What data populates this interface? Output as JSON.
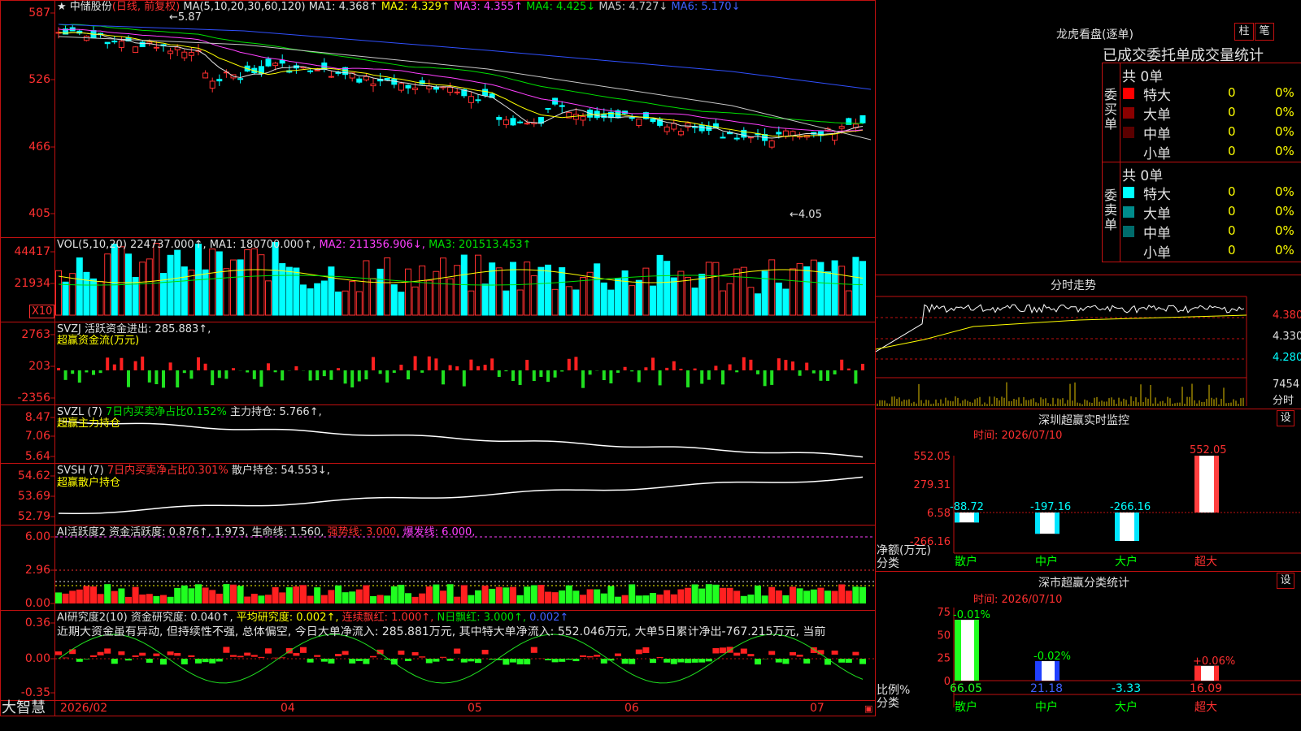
{
  "logo_text": "大智慧",
  "stock": {
    "name": "中储股份",
    "mode": "(日线, 前复权)",
    "ma_label": "MA(5,10,20,30,60,120)",
    "ma1": "MA1: 4.368↑",
    "ma2": "MA2: 4.329↑",
    "ma3": "MA3: 4.355↑",
    "ma4": "MA4: 4.425↓",
    "ma5": "MA5: 4.727↓",
    "ma6": "MA6: 5.170↓",
    "high_mark": "←5.87",
    "low_mark": "←4.05",
    "axis": [
      "587",
      "526",
      "466",
      "405"
    ]
  },
  "vol": {
    "label": "VOL(5,10,20)",
    "value": "224737.000↑,",
    "ma1": "MA1: 180700.000↑,",
    "ma2": "MA2: 211356.906↓,",
    "ma3": "MA3: 201513.453↑",
    "axis": [
      "44417",
      "21934"
    ],
    "unit": "X10"
  },
  "svzj": {
    "label": "SVZJ",
    "text": "活跃资金进出: 285.883↑,",
    "sub": "超赢资金流(万元)",
    "axis": [
      "2763",
      "203",
      "-2356"
    ]
  },
  "svzl": {
    "label": "SVZL (7)",
    "t1": "7日内买卖净占比0.152%",
    "t2": "主力持仓: 5.766↑,",
    "sub": "超赢主力持仓",
    "axis": [
      "8.47",
      "7.06",
      "5.64"
    ]
  },
  "svsh": {
    "label": "SVSH (7)",
    "t1": "7日内买卖净占比0.301%",
    "t2": "散户持仓: 54.553↓,",
    "sub": "超赢散户持仓",
    "axis": [
      "54.62",
      "53.69",
      "52.79"
    ]
  },
  "ai1": {
    "label": "AI活跃度2",
    "t1": "资金活跃度: 0.876↑,",
    "t2": "1.973,",
    "t3": "生命线: 1.560,",
    "t4": "强势线: 3.000,",
    "t5": "爆发线: 6.000,",
    "axis": [
      "6.00",
      "2.96",
      "0.00"
    ]
  },
  "ai2": {
    "label": "AI研究度2(10)",
    "t1": "资金研究度: 0.040↑,",
    "t2": "平均研究度: 0.002↑,",
    "t3": "连续飘红: 1.000↑,",
    "t4": "N日飘红: 3.000↑,",
    "t5": "0.002↑",
    "comment": "近期大资金虽有异动, 但持续性不强, 总体偏空, 今日大单净流入: 285.881万元, 其中特大单净流入: 552.046万元, 大单5日累计净出-767.215万元, 当前",
    "axis": [
      "0.36",
      "0.00",
      "-0.35"
    ]
  },
  "dates": [
    "2026/02",
    "04",
    "05",
    "06",
    "07"
  ],
  "dragon": {
    "title": "龙虎看盘(逐单)",
    "btn_bar": "柱",
    "btn_pen": "笔",
    "header": "已成交委托单成交量统计",
    "buy_label": "委买单",
    "sell_label": "委卖单",
    "buy_total": "共 0单",
    "sell_total": "共 0单",
    "buy_rows": [
      {
        "name": "特大",
        "n": "0",
        "pct": "0%",
        "color": "#ff0000"
      },
      {
        "name": "大单",
        "n": "0",
        "pct": "0%",
        "color": "#8b0000"
      },
      {
        "name": "中单",
        "n": "0",
        "pct": "0%",
        "color": "#5a0000"
      },
      {
        "name": "小单",
        "n": "0",
        "pct": "0%",
        "color": "#000000"
      }
    ],
    "sell_rows": [
      {
        "name": "特大",
        "n": "0",
        "pct": "0%",
        "color": "#00ffff"
      },
      {
        "name": "大单",
        "n": "0",
        "pct": "0%",
        "color": "#008b8b"
      },
      {
        "name": "中单",
        "n": "0",
        "pct": "0%",
        "color": "#006b6b"
      },
      {
        "name": "小单",
        "n": "0",
        "pct": "0%",
        "color": "#000000"
      }
    ]
  },
  "intraday": {
    "title": "分时走势",
    "axis": [
      "4.380",
      "4.330",
      "4.280",
      "7454"
    ],
    "vol_label": "分时"
  },
  "monitor": {
    "title": "深圳超赢实时监控",
    "btn": "设",
    "time": "时间: 2026/07/10",
    "axis": [
      "552.05",
      "279.31",
      "6.58",
      "-266.16"
    ],
    "ylabel": "净额(万元)",
    "xlabel": "分类",
    "categories": [
      "散户",
      "中户",
      "大户",
      "超大"
    ],
    "values": [
      "-88.72",
      "-197.16",
      "-266.16",
      "552.05"
    ]
  },
  "classify": {
    "title": "深市超赢分类统计",
    "btn": "设",
    "time": "时间: 2026/07/10",
    "axis": [
      "75",
      "50",
      "25",
      "0"
    ],
    "ylabel": "比例%",
    "xlabel": "分类",
    "categories": [
      "散户",
      "中户",
      "大户",
      "超大"
    ],
    "top_labels": [
      "-0.01%",
      "-0.02%",
      "",
      "+0.06%"
    ],
    "bottom_values": [
      "66.05",
      "21.18",
      "-3.33",
      "16.09"
    ]
  },
  "chart_data": {
    "type": "bar",
    "title": "深圳超赢实时监控",
    "categories": [
      "散户",
      "中户",
      "大户",
      "超大"
    ],
    "values": [
      -88.72,
      -197.16,
      -266.16,
      552.05
    ],
    "ylabel": "净额(万元)",
    "ylim": [
      -266.16,
      552.05
    ]
  }
}
